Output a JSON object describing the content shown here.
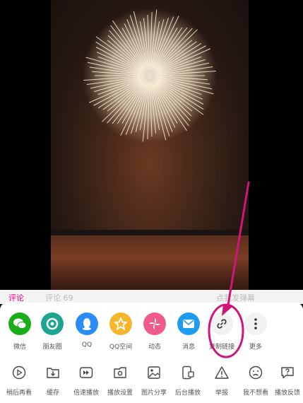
{
  "behind_bar": {
    "tab_left": "评论",
    "comments": "评论 69",
    "send_danmaku": "点我发弹幕"
  },
  "share_targets": [
    {
      "label": "微信",
      "icon": "wechat-icon",
      "color": "#1AAD19"
    },
    {
      "label": "朋友圈",
      "icon": "moments-icon",
      "color": "#1FA58F"
    },
    {
      "label": "QQ",
      "icon": "qq-icon",
      "color": "#2B8CF7"
    },
    {
      "label": "QQ空间",
      "icon": "qzone-icon",
      "color": "#F7B52C"
    },
    {
      "label": "动态",
      "icon": "pinwheel-icon",
      "color": "#F15B8C"
    },
    {
      "label": "消息",
      "icon": "mail-icon",
      "color": "#1E9CF0"
    },
    {
      "label": "复制链接",
      "icon": "link-icon",
      "color": "#F2F2F2"
    },
    {
      "label": "更多",
      "icon": "more-icon",
      "color": "#F2F2F2"
    }
  ],
  "actions": [
    {
      "label": "稍后再看",
      "icon": "watch-later-icon"
    },
    {
      "label": "缓存",
      "icon": "download-icon"
    },
    {
      "label": "倍速播放",
      "icon": "speed-icon"
    },
    {
      "label": "播放设置",
      "icon": "settings-icon"
    },
    {
      "label": "图片分享",
      "icon": "image-share-icon"
    },
    {
      "label": "后台播放",
      "icon": "background-play-icon"
    },
    {
      "label": "举报",
      "icon": "report-icon"
    },
    {
      "label": "我不想看",
      "icon": "dislike-icon"
    },
    {
      "label": "播放反馈",
      "icon": "feedback-icon"
    }
  ],
  "annotation_color": "#D0157A"
}
